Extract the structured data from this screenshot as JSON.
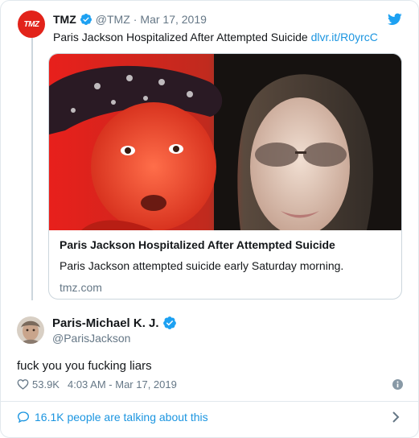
{
  "colors": {
    "accent": "#1b95e0",
    "verified": "#1da1f2",
    "tmz_red": "#e2231a",
    "muted": "#657786",
    "text": "#14171a",
    "border": "#ccd6dd"
  },
  "quoted_tweet": {
    "avatar_text": "TMZ",
    "name": "TMZ",
    "handle": "@TMZ",
    "separator": "·",
    "date": "Mar 17, 2019",
    "text": "Paris Jackson Hospitalized After Attempted Suicide",
    "link": "dlvr.it/R0yrcC",
    "card": {
      "title": "Paris Jackson Hospitalized After Attempted Suicide",
      "description": "Paris Jackson attempted suicide early Saturday morning.",
      "domain": "tmz.com"
    }
  },
  "reply_tweet": {
    "name": "Paris-Michael K. J.",
    "handle": "@ParisJackson",
    "text": "fuck you you fucking liars",
    "likes": "53.9K",
    "timestamp": "4:03 AM - Mar 17, 2019",
    "talking": "16.1K people are talking about this"
  },
  "icons": {
    "verified": "verified-badge-icon",
    "bird": "twitter-bird-icon",
    "heart": "heart-icon",
    "info": "info-icon",
    "bubble": "speech-bubble-icon",
    "chevron": "chevron-right-icon"
  }
}
